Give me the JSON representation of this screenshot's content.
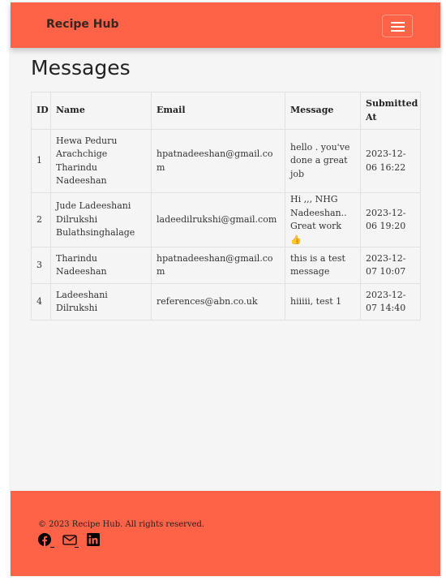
{
  "navbar": {
    "brand": "Recipe Hub",
    "menu_icon": "hamburger-menu-icon"
  },
  "page": {
    "title": "Messages"
  },
  "table": {
    "headers": [
      "ID",
      "Name",
      "Email",
      "Message",
      "Submitted At"
    ],
    "rows": [
      {
        "id": "1",
        "name": "Hewa Peduru Arachchige Tharindu Nadeeshan",
        "email": "hpatnadeeshan@gmail.com",
        "message": "hello . you've done a great job",
        "submitted_at": "2023-12-06 16:22"
      },
      {
        "id": "2",
        "name": "Jude Ladeeshani Dilrukshi Bulathsinghalage",
        "email": "ladeedilrukshi@gmail.com",
        "message": "Hi ,,, NHG Nadeeshan.. Great work",
        "message_emoji": "👍",
        "submitted_at": "2023-12-06 19:20"
      },
      {
        "id": "3",
        "name": "Tharindu Nadeeshan",
        "email": "hpatnadeeshan@gmail.com",
        "message": "this is a test message",
        "submitted_at": "2023-12-07 10:07"
      },
      {
        "id": "4",
        "name": "Ladeeshani Dilrukshi",
        "email": "references@abn.co.uk",
        "message": "hiiiii, test 1",
        "submitted_at": "2023-12-07 14:40"
      }
    ]
  },
  "footer": {
    "copyright": "© 2023 Recipe Hub. All rights reserved.",
    "social_icons": [
      "facebook-icon",
      "envelope-icon",
      "linkedin-icon"
    ]
  },
  "colors": {
    "brand_accent": "#ff6347",
    "page_background": "#f5f5f5"
  }
}
